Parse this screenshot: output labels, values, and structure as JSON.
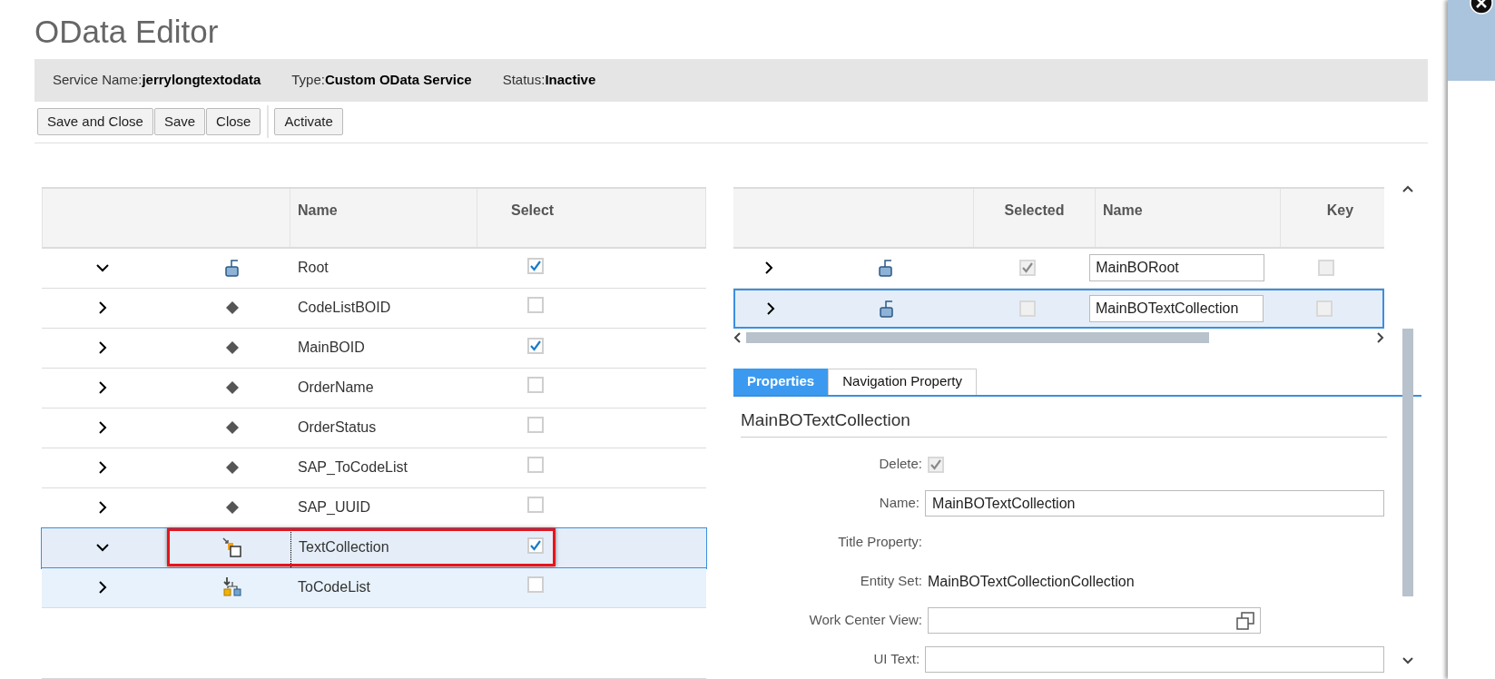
{
  "title": "OData Editor",
  "info": [
    {
      "label": "Service Name:",
      "value": "jerrylongtextodata"
    },
    {
      "label": "Type:",
      "value": "Custom OData Service"
    },
    {
      "label": "Status:",
      "value": "Inactive"
    }
  ],
  "toolbar": [
    [
      "Save and Close",
      "Save",
      "Close"
    ],
    [
      "Activate"
    ]
  ],
  "tree": {
    "columns": [
      "Name",
      "Select"
    ],
    "rows": [
      {
        "expanded": true,
        "kind": "entity",
        "name": "Root",
        "checked": true,
        "selected": false,
        "hovered": false,
        "annotated": false
      },
      {
        "expanded": false,
        "kind": "element",
        "name": "CodeListBOID",
        "checked": false,
        "selected": false,
        "hovered": false,
        "annotated": false
      },
      {
        "expanded": false,
        "kind": "element",
        "name": "MainBOID",
        "checked": true,
        "selected": false,
        "hovered": false,
        "annotated": false
      },
      {
        "expanded": false,
        "kind": "element",
        "name": "OrderName",
        "checked": false,
        "selected": false,
        "hovered": false,
        "annotated": false
      },
      {
        "expanded": false,
        "kind": "element",
        "name": "OrderStatus",
        "checked": false,
        "selected": false,
        "hovered": false,
        "annotated": false
      },
      {
        "expanded": false,
        "kind": "element",
        "name": "SAP_ToCodeList",
        "checked": false,
        "selected": false,
        "hovered": false,
        "annotated": false
      },
      {
        "expanded": false,
        "kind": "element",
        "name": "SAP_UUID",
        "checked": false,
        "selected": false,
        "hovered": false,
        "annotated": false
      },
      {
        "expanded": true,
        "kind": "collection",
        "name": "TextCollection",
        "checked": true,
        "selected": true,
        "hovered": false,
        "annotated": true
      },
      {
        "expanded": false,
        "kind": "association",
        "name": "ToCodeList",
        "checked": false,
        "selected": false,
        "hovered": true,
        "annotated": false
      }
    ]
  },
  "entities": {
    "columns": [
      "Selected",
      "Name",
      "Key"
    ],
    "rows": [
      {
        "expanded": false,
        "kind": "entity",
        "checked": true,
        "disabled": true,
        "name": "MainBORoot",
        "key": false,
        "selected": false
      },
      {
        "expanded": false,
        "kind": "entity",
        "checked": false,
        "disabled": true,
        "name": "MainBOTextCollection",
        "key": false,
        "selected": true
      }
    ]
  },
  "tabs": [
    {
      "label": "Properties",
      "selected": true
    },
    {
      "label": "Navigation Property",
      "selected": false
    }
  ],
  "properties": {
    "heading": "MainBOTextCollection",
    "fields": [
      {
        "kind": "checkbox",
        "label": "Delete:",
        "checked": true,
        "disabled": true
      },
      {
        "kind": "input",
        "label": "Name:",
        "value": "MainBOTextCollection"
      },
      {
        "kind": "text",
        "label": "Title Property:"
      },
      {
        "kind": "text",
        "label": "Entity Set:",
        "value": "MainBOTextCollectionCollection"
      },
      {
        "kind": "picker",
        "label": "Work Center View:"
      },
      {
        "kind": "input",
        "label": "UI Text:"
      }
    ]
  }
}
